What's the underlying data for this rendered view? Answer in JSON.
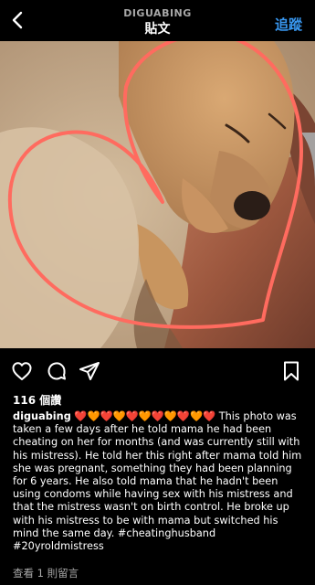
{
  "header": {
    "username": "DIGUABING",
    "title": "貼文",
    "follow_label": "追蹤"
  },
  "post": {
    "likes": "116 個讚",
    "caption_user": "diguabing",
    "caption_hearts": "❤️🧡❤️🧡❤️🧡❤️🧡❤️🧡❤️",
    "caption_text": "This photo was taken a few days after he told mama he had been cheating on her for months (and was currently still with his mistress). He told her this right after mama told him she was pregnant, something they had been planning for 6 years. He also told mama that he hadn't been using condoms while having sex with his mistress and that the mistress wasn't on birth control. He broke up with his mistress to be with mama but switched his mind the same day. #cheatinghusband #20yroldmistress",
    "comments_link": "查看 1 則留言"
  },
  "icons": {
    "back": "chevron-left-icon",
    "like": "heart-icon",
    "comment": "comment-bubble-icon",
    "share": "paper-plane-icon",
    "save": "bookmark-icon",
    "tagged": "person-icon"
  },
  "colors": {
    "background": "#000000",
    "accent": "#3897f0",
    "muted": "#a8a8a8",
    "drawn_heart": "#ff6b5f"
  }
}
